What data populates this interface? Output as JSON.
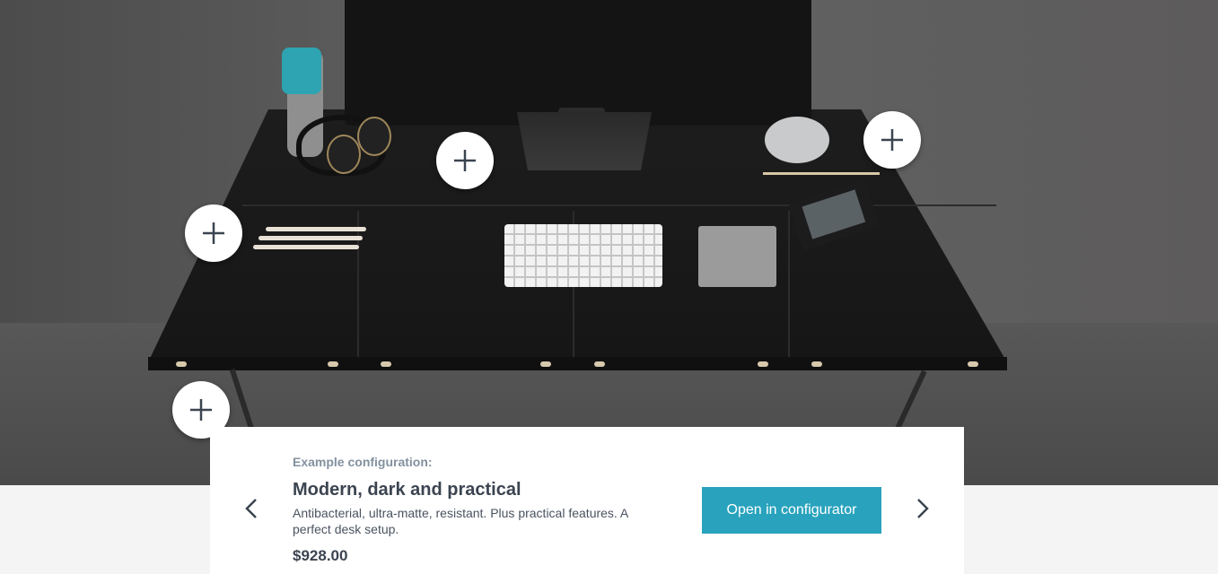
{
  "hero": {
    "image_alt": "Black desk with monitor, keyboard, trackpad, headphones, water bottle and e-reader",
    "hotspot_icon": "plus-icon"
  },
  "card": {
    "eyebrow": "Example configuration:",
    "title": "Modern, dark and practical",
    "description": "Antibacterial, ultra-matte, resistant. Plus practical features. A perfect desk setup.",
    "price": "$928.00",
    "cta_label": "Open in configurator",
    "prev_icon": "chevron-left-icon",
    "next_icon": "chevron-right-icon"
  },
  "colors": {
    "accent": "#29a3bd",
    "title_text": "#3b4450",
    "eyebrow_text": "#8391a0"
  }
}
